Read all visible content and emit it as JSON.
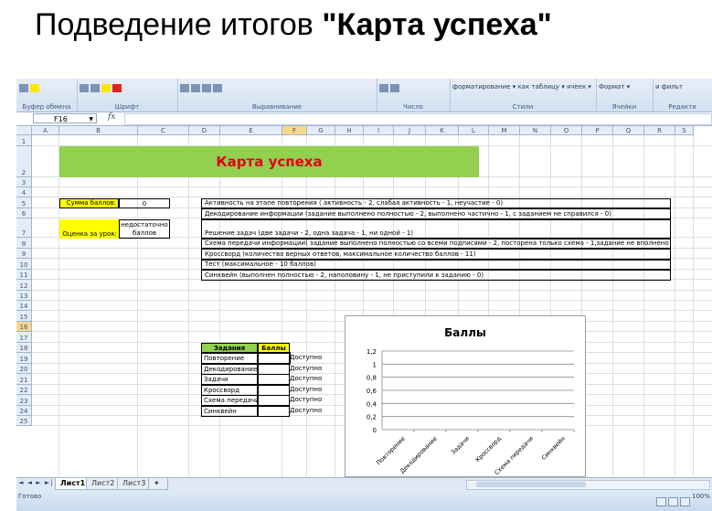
{
  "slide_title": {
    "prefix": "Подведение итогов ",
    "bold": "\"Карта успеха\""
  },
  "ribbon": {
    "groups": [
      {
        "label": "Буфер обмена",
        "text": ""
      },
      {
        "label": "Шрифт",
        "text": ""
      },
      {
        "label": "Выравнивание",
        "text": ""
      },
      {
        "label": "Число",
        "text": ""
      },
      {
        "label": "Стили",
        "text": "форматирование ▾  как таблицу ▾  ячеек ▾"
      },
      {
        "label": "Ячейки",
        "text": "Формат ▾"
      },
      {
        "label": "Редакти",
        "text": "и фильт"
      }
    ]
  },
  "formula_bar": {
    "name_box": "F16",
    "fx": "fx",
    "formula": ""
  },
  "columns": [
    "A",
    "B",
    "C",
    "D",
    "E",
    "F",
    "G",
    "H",
    "I",
    "J",
    "K",
    "L",
    "M",
    "N",
    "O",
    "P",
    "Q",
    "R",
    "S"
  ],
  "selected_column": "F",
  "rows": [
    "1",
    "2",
    "3",
    "4",
    "5",
    "6",
    "7",
    "8",
    "9",
    "10",
    "11",
    "12",
    "13",
    "14",
    "15",
    "16",
    "17",
    "18",
    "19",
    "20",
    "21",
    "22",
    "23",
    "24",
    "25"
  ],
  "selected_row": "16",
  "sheet": {
    "banner": "Карта успеха",
    "score_label": "Сумма баллов:",
    "score_value": "0",
    "grade_label": "Оценка за урок:",
    "grade_value": "недостаточно баллов",
    "criteria": [
      "Активность на этапе повторения ( активность - 2, слабая активность - 1, неучастие - 0)",
      "Декодирование информации (задание выполнено полностью - 2, выполнено частично - 1, с заданием не справился - 0)",
      "Решение задач (две задачи - 2, одна задача - 1, ни одной - 1)",
      "Схема передачи информации( задание выполнено полностью со всеми подписями - 2, посторена только схема - 1,задание не вполнено - 0)",
      "Кроссворд (количество верных ответов, максимальное количество баллов - 11)",
      "Тест (максимальное - 10 баллов)",
      "Синквейн (выполнен полностью - 2, наполовину - 1, не приступили к заданию - 0)"
    ],
    "table": {
      "header_task": "Задания",
      "header_score": "Баллы",
      "rows": [
        {
          "task": "Повторение",
          "score": "",
          "status": "Доступно"
        },
        {
          "task": "Декодирование",
          "score": "",
          "status": "Доступно"
        },
        {
          "task": "Задачи",
          "score": "",
          "status": "Доступно"
        },
        {
          "task": "Кроссворд",
          "score": "",
          "status": "Доступно"
        },
        {
          "task": "Схема передачи",
          "score": "",
          "status": "Доступно"
        },
        {
          "task": "Синквейн",
          "score": "",
          "status": "Доступно"
        }
      ]
    }
  },
  "chart_data": {
    "type": "bar",
    "title": "Баллы",
    "categories": [
      "Повторение",
      "Декодирование",
      "Задачи",
      "Кроссворд",
      "Схема передачи",
      "Синквейн"
    ],
    "values": [
      0,
      0,
      0,
      0,
      0,
      0
    ],
    "y_ticks": [
      "0",
      "0,2",
      "0,4",
      "0,6",
      "0,8",
      "1",
      "1,2"
    ],
    "ylim": [
      0,
      1.2
    ],
    "grid": true,
    "xlabel": "",
    "ylabel": ""
  },
  "tabs": {
    "nav": "◄ ◄ ► ►|",
    "sheets": [
      "Лист1",
      "Лист2",
      "Лист3"
    ],
    "active": "Лист1"
  },
  "status": {
    "ready": "Готово",
    "zoom": "100%"
  }
}
